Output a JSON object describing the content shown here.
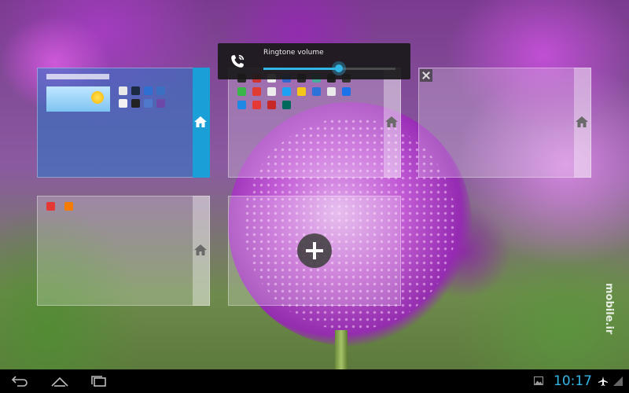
{
  "volume_panel": {
    "title": "Ringtone volume",
    "level": 0.57,
    "icon": "phone-ringtone-icon",
    "accent": "#33b5e5"
  },
  "home_screens": [
    {
      "id": 1,
      "active": true,
      "icon": "home-icon"
    },
    {
      "id": 2,
      "active": false,
      "icon": "home-icon"
    },
    {
      "id": 3,
      "active": false,
      "icon": "home-icon",
      "closable": true
    },
    {
      "id": 4,
      "active": false,
      "icon": "home-icon"
    },
    {
      "id": 5,
      "type": "add",
      "icon": "plus-icon"
    }
  ],
  "status_bar": {
    "time": "10:17",
    "icons": [
      "gallery-icon",
      "airplane-icon",
      "signal-icon"
    ]
  },
  "nav_buttons": [
    "back-icon",
    "home-icon",
    "recent-apps-icon"
  ],
  "watermark": "mobile.ir"
}
